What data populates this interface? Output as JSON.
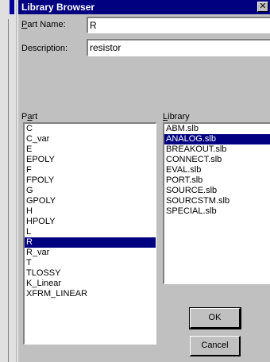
{
  "window": {
    "title": "Library Browser",
    "close_label": "✕"
  },
  "form": {
    "part_name_label_prefix": "P",
    "part_name_label_rest": "art Name:",
    "part_name_value": "R",
    "description_label": "Description:",
    "description_value": "resistor"
  },
  "part_list": {
    "label_prefix": "P",
    "label_underlined": "a",
    "label_rest": "rt",
    "items": [
      "C",
      "C_var",
      "E",
      "EPOLY",
      "F",
      "FPOLY",
      "G",
      "GPOLY",
      "H",
      "HPOLY",
      "L",
      "R",
      "R_var",
      "T",
      "TLOSSY",
      "K_Linear",
      "XFRM_LINEAR"
    ],
    "selected": "R"
  },
  "library_list": {
    "label_underlined": "L",
    "label_rest": "ibrary",
    "items": [
      "ABM.slb",
      "ANALOG.slb",
      "BREAKOUT.slb",
      "CONNECT.slb",
      "EVAL.slb",
      "PORT.slb",
      "SOURCE.slb",
      "SOURCSTM.slb",
      "SPECIAL.slb"
    ],
    "selected": "ANALOG.slb"
  },
  "buttons": {
    "ok_label": "OK",
    "cancel_label": "Cancel"
  },
  "colors": {
    "titlebar": "#000080",
    "selection": "#000080",
    "face": "#c0c0c0"
  }
}
